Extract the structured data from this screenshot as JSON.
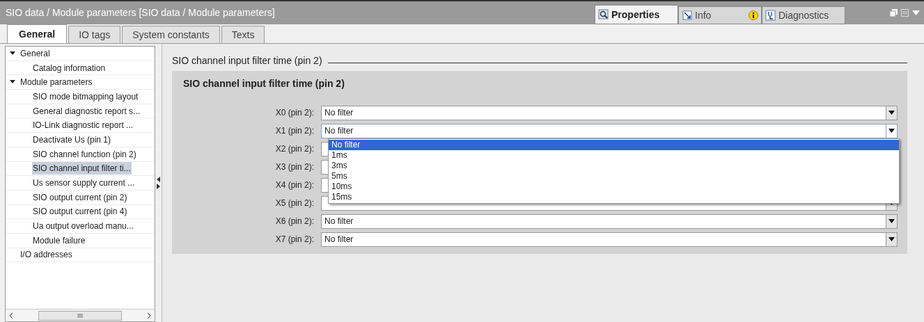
{
  "window": {
    "title": "SIO data / Module parameters [SIO data / Module parameters]"
  },
  "inspector_tabs": [
    {
      "label": "Properties",
      "selected": true,
      "kind": "properties"
    },
    {
      "label": "Info",
      "selected": false,
      "kind": "info"
    },
    {
      "label": "Diagnostics",
      "selected": false,
      "kind": "diagnostics"
    }
  ],
  "tabs": [
    {
      "label": "General",
      "selected": true
    },
    {
      "label": "IO tags",
      "selected": false
    },
    {
      "label": "System constants",
      "selected": false
    },
    {
      "label": "Texts",
      "selected": false
    }
  ],
  "sidebar": {
    "items": [
      {
        "label": "General",
        "expanded": true,
        "selected": false,
        "children": [
          {
            "label": "Catalog information",
            "selected": false
          }
        ]
      },
      {
        "label": "Module parameters",
        "expanded": true,
        "selected": false,
        "children": [
          {
            "label": "SIO mode bitmapping layout",
            "selected": false
          },
          {
            "label": "General diagnostic report s...",
            "selected": false
          },
          {
            "label": "IO-Link diagnostic report ...",
            "selected": false
          },
          {
            "label": "Deactivate Us (pin 1)",
            "selected": false
          },
          {
            "label": "SIO channel function (pin 2)",
            "selected": false
          },
          {
            "label": "SIO channel input filter ti...",
            "selected": true
          },
          {
            "label": "Us sensor supply current ...",
            "selected": false
          },
          {
            "label": "SIO output current (pin 2)",
            "selected": false
          },
          {
            "label": "SIO output current (pin 4)",
            "selected": false
          },
          {
            "label": "Ua output overload manu...",
            "selected": false
          },
          {
            "label": "Module failure",
            "selected": false
          }
        ]
      },
      {
        "label": "I/O addresses",
        "selected": false
      }
    ]
  },
  "section": {
    "heading": "SIO channel input filter time (pin 2)",
    "group_title": "SIO channel input filter time (pin 2)",
    "fields": [
      {
        "label": "X0 (pin 2):",
        "value": "No filter",
        "expanded": false
      },
      {
        "label": "X1 (pin 2):",
        "value": "No filter",
        "expanded": true,
        "options": [
          {
            "label": "No filter",
            "selected": true
          },
          {
            "label": "1ms",
            "selected": false
          },
          {
            "label": "3ms",
            "selected": false
          },
          {
            "label": "5ms",
            "selected": false
          },
          {
            "label": "10ms",
            "selected": false
          },
          {
            "label": "15ms",
            "selected": false
          }
        ]
      },
      {
        "label": "X2 (pin 2):",
        "expanded": false
      },
      {
        "label": "X3 (pin 2):",
        "expanded": false
      },
      {
        "label": "X4 (pin 2):",
        "expanded": false
      },
      {
        "label": "X5 (pin 2):",
        "expanded": false
      },
      {
        "label": "X6 (pin 2):",
        "value": "No filter",
        "expanded": false
      },
      {
        "label": "X7 (pin 2):",
        "value": "No filter",
        "expanded": false
      }
    ]
  }
}
